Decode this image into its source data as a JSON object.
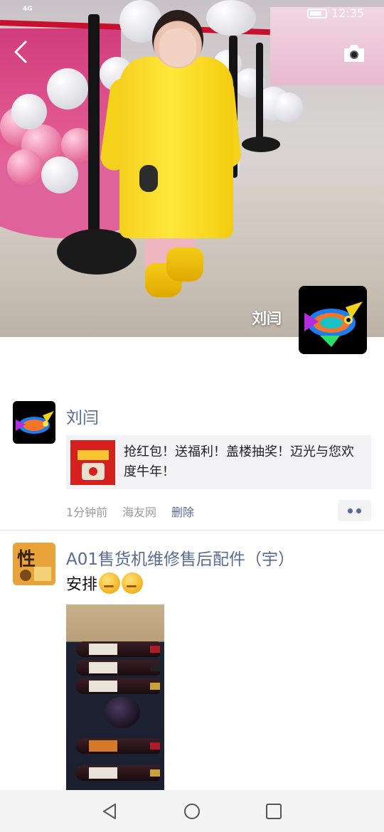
{
  "status_bar": {
    "signal_text": "4G",
    "time": "12:35"
  },
  "cover": {
    "owner_name": "刘闫"
  },
  "posts": [
    {
      "author": "刘闫",
      "link_title": "抢红包！送福利！盖楼抽奖！迈光与您欢度牛年！",
      "time_ago": "1分钟前",
      "source": "海友网",
      "delete_label": "删除"
    },
    {
      "author": "A01售货机维修售后配件（宇）",
      "text": "安排"
    }
  ],
  "icons": {
    "back": "chevron-left-icon",
    "camera": "camera-icon",
    "more": "more-dots-icon",
    "nav_back": "triangle-back-icon",
    "nav_home": "circle-home-icon",
    "nav_recent": "square-recent-icon"
  },
  "colors": {
    "link_blue": "#576b95",
    "meta_gray": "#9b9b9b",
    "card_bg": "#f3f3f5"
  }
}
